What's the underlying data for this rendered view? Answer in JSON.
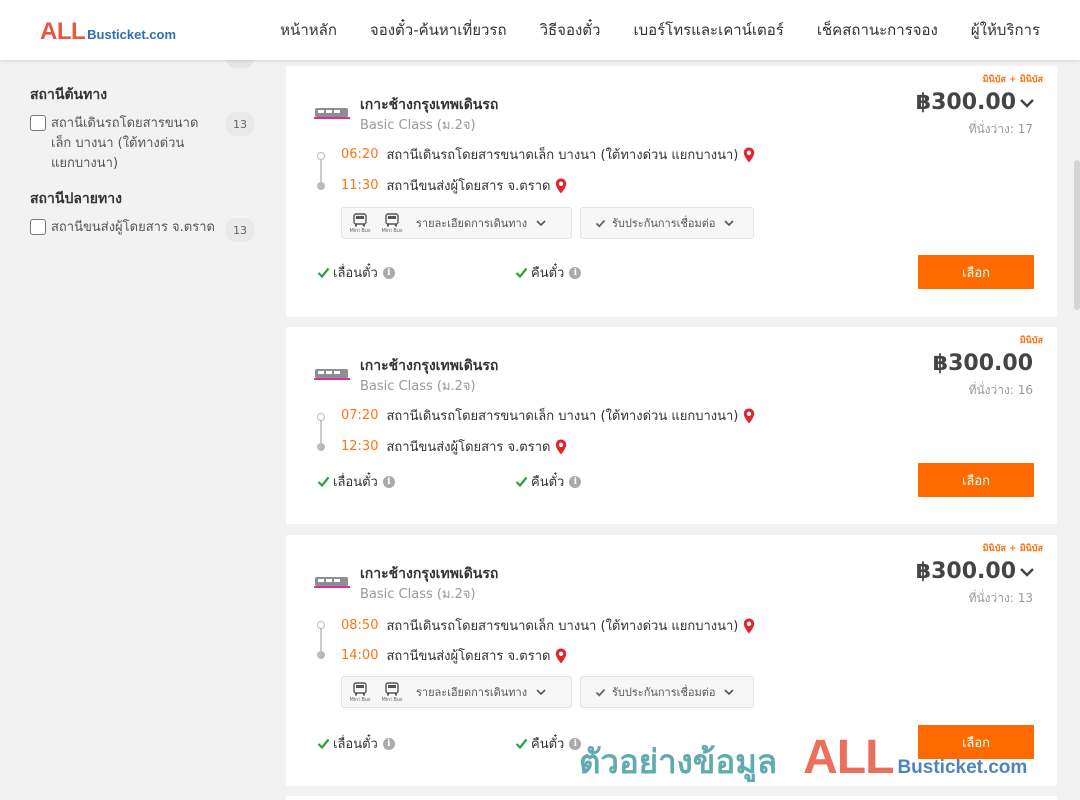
{
  "header": {
    "logo_all": "ALL",
    "logo_rest": "Busticket.com",
    "nav": [
      "หน้าหลัก",
      "จองตั๋ว-ค้นหาเที่ยวรถ",
      "วิธีจองตั๋ว",
      "เบอร์โทรและเคาน์เตอร์",
      "เช็คสถานะการจอง",
      "ผู้ให้บริการ"
    ]
  },
  "sidebar": {
    "origin": {
      "title": "สถานีต้นทาง",
      "items": [
        {
          "label": "สถานีเดินรถโดยสารขนาดเล็ก บางนา (ใต้ทางด่วน แยกบางนา)",
          "count": "13"
        }
      ]
    },
    "destination": {
      "title": "สถานีปลายทาง",
      "items": [
        {
          "label": "สถานีขนส่งผู้โดยสาร จ.ตราด",
          "count": "13"
        }
      ]
    }
  },
  "trips": [
    {
      "tag": "มินิบัส + มินิบัส",
      "title": "เกาะช้างกรุงเทพเดินรถ",
      "class": "Basic Class (ม.2จ)",
      "price": "฿300.00",
      "seats": "ที่นั่งว่าง: 17",
      "depart_time": "06:20",
      "depart_station": "สถานีเดินรถโดยสารขนาดเล็ก บางนา (ใต้ทางด่วน แยกบางนา)",
      "arrive_time": "11:30",
      "arrive_station": "สถานีขนส่งผู้โดยสาร จ.ตราด",
      "bus_label": "Mini Bus",
      "details_label": "รายละเอียดการเดินทาง",
      "guarantee_label": "รับประกันการเชื่อมต่อ",
      "postpone": "เลื่อนตั๋ว",
      "refund": "คืนตั๋ว",
      "select": "เลือก"
    },
    {
      "tag": "มินิบัส",
      "title": "เกาะช้างกรุงเทพเดินรถ",
      "class": "Basic Class (ม.2จ)",
      "price": "฿300.00",
      "seats": "ที่นั่งว่าง: 16",
      "depart_time": "07:20",
      "depart_station": "สถานีเดินรถโดยสารขนาดเล็ก บางนา (ใต้ทางด่วน แยกบางนา)",
      "arrive_time": "12:30",
      "arrive_station": "สถานีขนส่งผู้โดยสาร จ.ตราด",
      "postpone": "เลื่อนตั๋ว",
      "refund": "คืนตั๋ว",
      "select": "เลือก"
    },
    {
      "tag": "มินิบัส + มินิบัส",
      "title": "เกาะช้างกรุงเทพเดินรถ",
      "class": "Basic Class (ม.2จ)",
      "price": "฿300.00",
      "seats": "ที่นั่งว่าง: 13",
      "depart_time": "08:50",
      "depart_station": "สถานีเดินรถโดยสารขนาดเล็ก บางนา (ใต้ทางด่วน แยกบางนา)",
      "arrive_time": "14:00",
      "arrive_station": "สถานีขนส่งผู้โดยสาร จ.ตราด",
      "bus_label": "Mini Bus",
      "details_label": "รายละเอียดการเดินทาง",
      "guarantee_label": "รับประกันการเชื่อมต่อ",
      "postpone": "เลื่อนตั๋ว",
      "refund": "คืนตั๋ว",
      "select": "เลือก"
    }
  ],
  "watermark": {
    "text": "ตัวอย่างข้อมูล",
    "logo_all": "ALL",
    "logo_rest": "Busticket.com"
  },
  "colors": {
    "accent": "#ff6a00",
    "time": "#ff7410",
    "pin": "#e0262d",
    "check": "#2e9e3e",
    "logo_red": "#e8573f",
    "logo_blue": "#2e6fb4"
  }
}
